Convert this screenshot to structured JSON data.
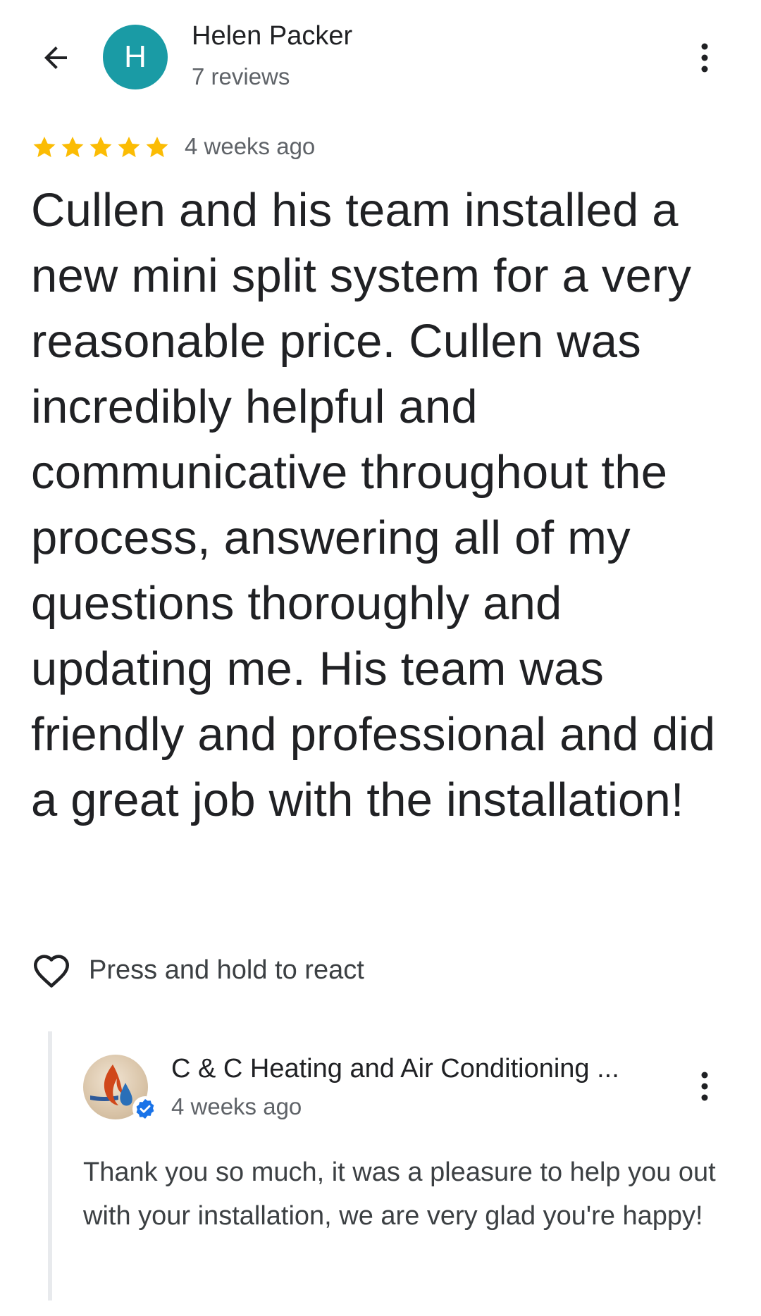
{
  "header": {
    "back_icon": "arrow-left-icon",
    "avatar_letter": "H",
    "avatar_color": "#1a9ba5",
    "user_name": "Helen Packer",
    "review_count": "7 reviews",
    "more_icon": "more-vertical-icon"
  },
  "review": {
    "rating": 5,
    "rating_max": 5,
    "star_color": "#fbbc04",
    "time": "4 weeks ago",
    "text": "Cullen and his team installed a new mini split system for a very reasonable price. Cullen was incredibly helpful and communicative throughout the process, answering all of my questions thoroughly and updating me. His team was friendly and professional and did a great job with the installation!"
  },
  "react": {
    "icon": "heart-outline-icon",
    "label": "Press and hold to react"
  },
  "owner_reply": {
    "avatar_icon": "flame-droplet-logo",
    "verified_icon": "verified-badge-icon",
    "verified_color": "#1a73e8",
    "name": "C & C Heating and Air Conditioning ...",
    "time": "4 weeks ago",
    "more_icon": "more-vertical-icon",
    "text": "Thank you so much, it was a pleasure to help you out with your installation, we are very glad you're happy!"
  }
}
